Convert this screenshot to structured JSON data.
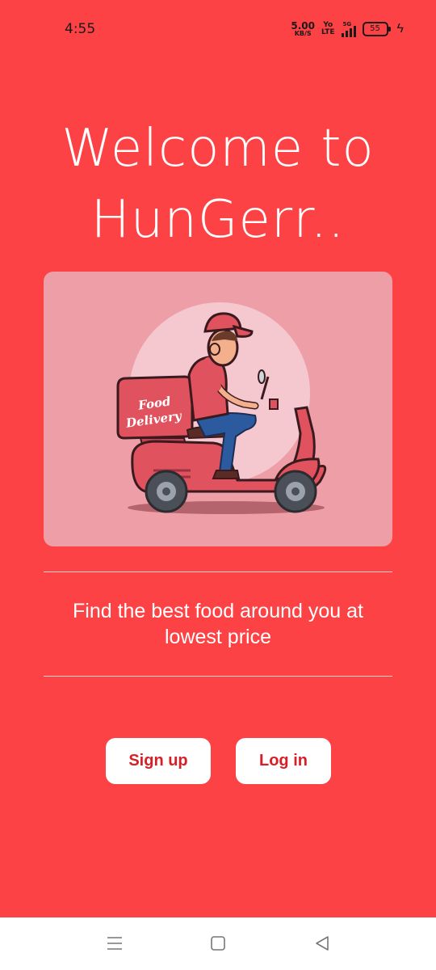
{
  "status_bar": {
    "time": "4:55",
    "net_speed_value": "5.00",
    "net_speed_unit": "KB/S",
    "volte_top": "Yo",
    "volte_bottom": "LTE",
    "network_type": "5G",
    "battery_level": "55"
  },
  "welcome": {
    "line1": "Welcome to",
    "line2": "HunGerr.."
  },
  "hero": {
    "image_icon": "scooter-delivery-illustration",
    "box_text_line1": "Food",
    "box_text_line2": "Delivery"
  },
  "tagline": {
    "line1": "Find the best food around you at",
    "line2": "lowest price"
  },
  "actions": {
    "signup_label": "Sign up",
    "login_label": "Log in"
  },
  "nav": {
    "menu_icon": "menu-icon",
    "home_icon": "home-icon",
    "back_icon": "back-icon"
  },
  "colors": {
    "background": "#fd4245",
    "button_text": "#d81f26",
    "card": "#ee9ea6"
  }
}
